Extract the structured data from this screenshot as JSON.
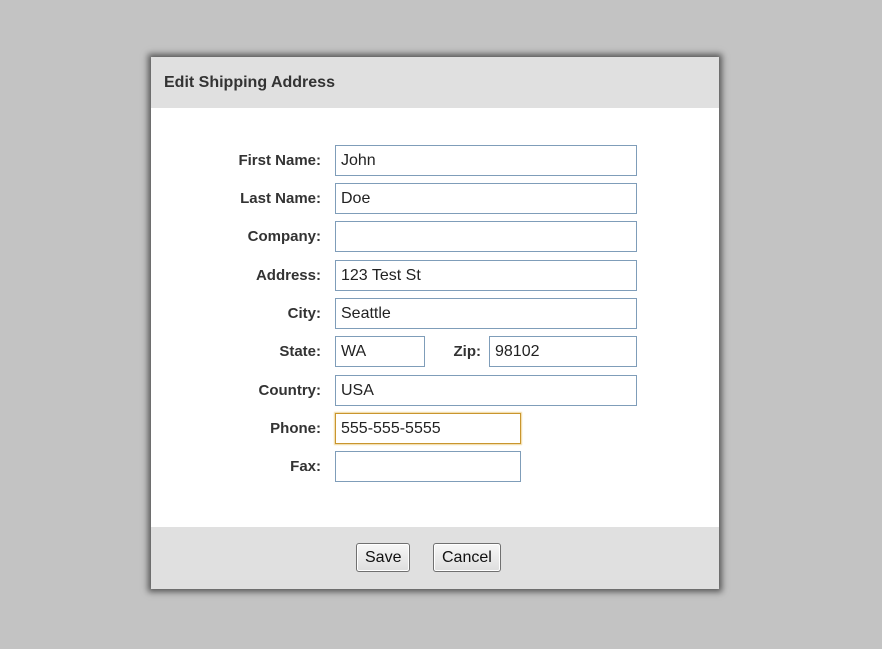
{
  "dialog": {
    "title": "Edit Shipping Address"
  },
  "form": {
    "first_name": {
      "label": "First Name:",
      "value": "John"
    },
    "last_name": {
      "label": "Last Name:",
      "value": "Doe"
    },
    "company": {
      "label": "Company:",
      "value": ""
    },
    "address": {
      "label": "Address:",
      "value": "123 Test St"
    },
    "city": {
      "label": "City:",
      "value": "Seattle"
    },
    "state": {
      "label": "State:",
      "value": "WA"
    },
    "zip": {
      "label": "Zip:",
      "value": "98102"
    },
    "country": {
      "label": "Country:",
      "value": "USA"
    },
    "phone": {
      "label": "Phone:",
      "value": "555-555-5555",
      "focused": true
    },
    "fax": {
      "label": "Fax:",
      "value": ""
    }
  },
  "footer": {
    "save_label": "Save",
    "cancel_label": "Cancel"
  },
  "colors": {
    "page_background": "#c3c3c3",
    "header_background": "#e0e0e0",
    "field_border": "#7f9db9",
    "focus_border": "#c9962e"
  }
}
